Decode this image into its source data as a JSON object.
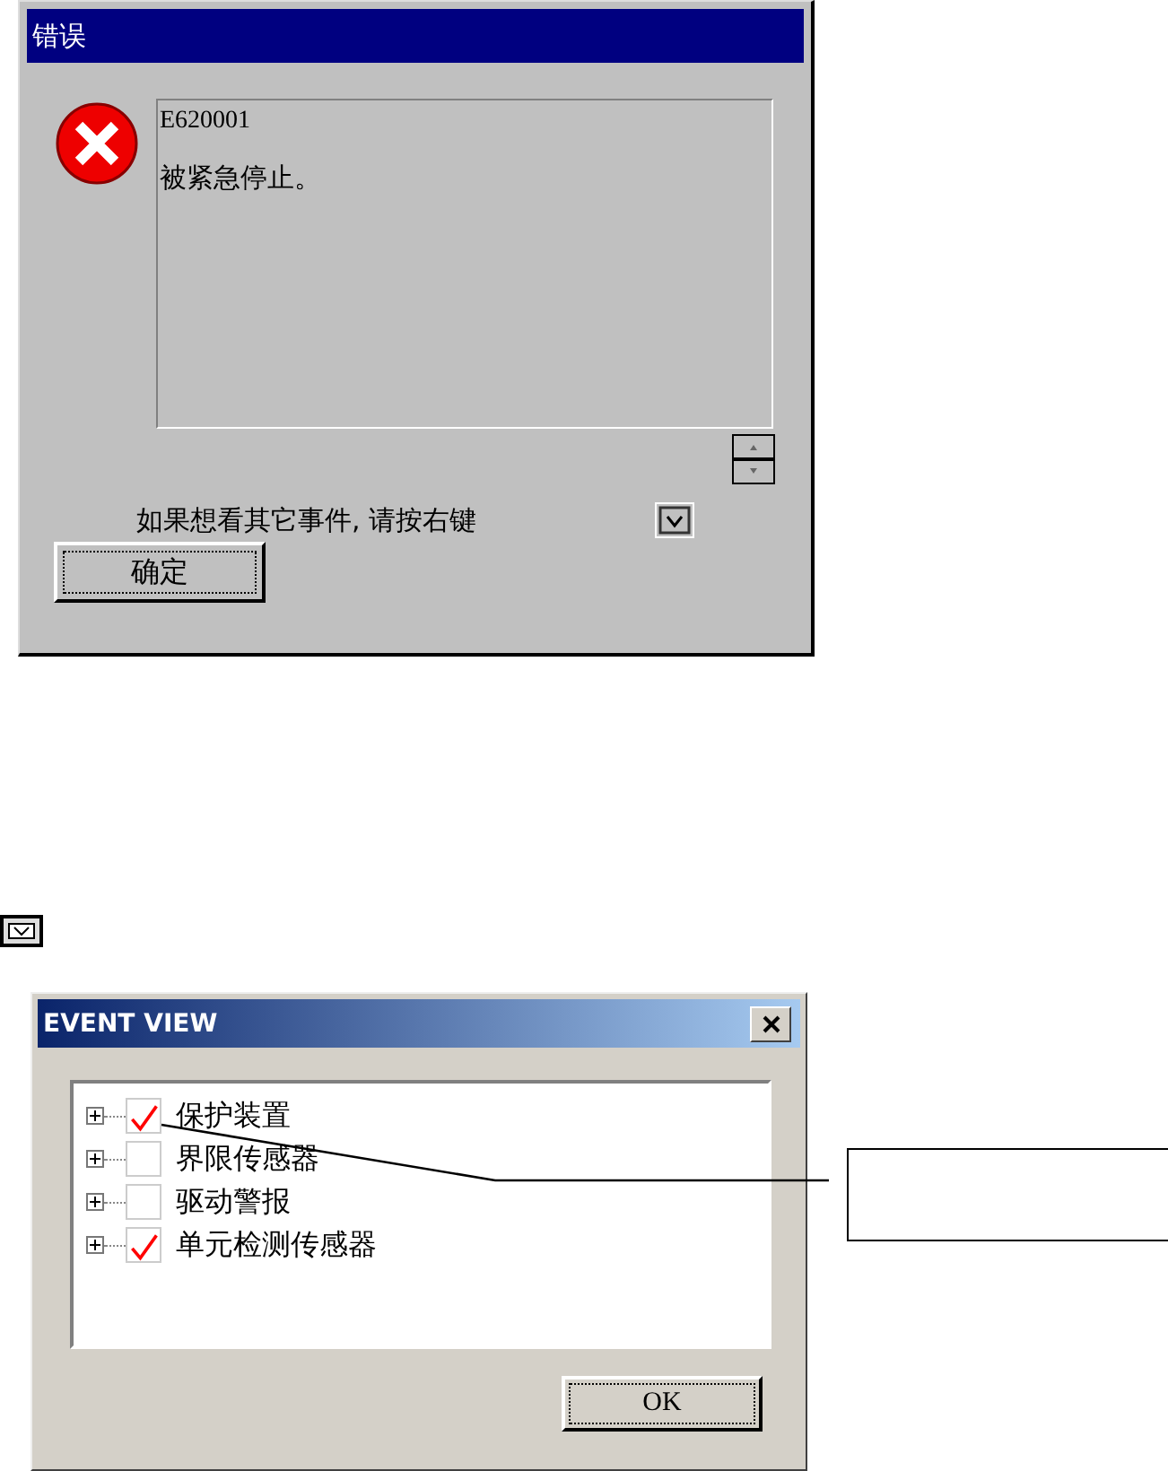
{
  "error_dialog": {
    "title": "错误",
    "code": "E620001",
    "message": "被紧急停止。",
    "hint": "如果想看其它事件, 请按右键",
    "ok_button": "确定"
  },
  "event_view": {
    "title": "EVENT VIEW",
    "items": [
      {
        "label": "保护装置",
        "checked": true
      },
      {
        "label": "界限传感器",
        "checked": false
      },
      {
        "label": "驱动警报",
        "checked": false
      },
      {
        "label": "单元检测传感器",
        "checked": true
      }
    ],
    "ok_button": "OK"
  }
}
